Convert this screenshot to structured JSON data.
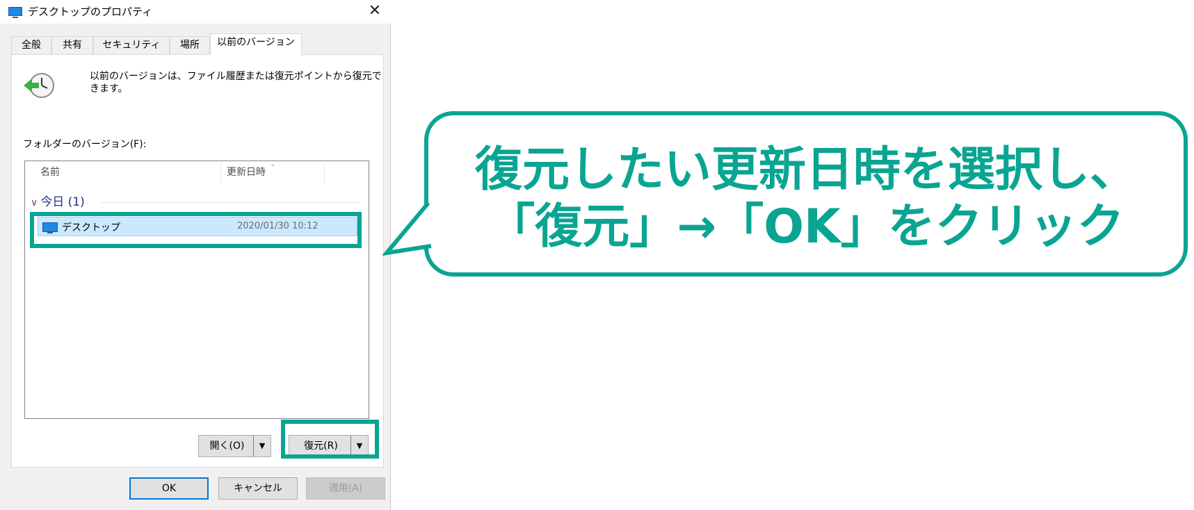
{
  "window": {
    "title": "デスクトップのプロパティ",
    "close_glyph": "✕"
  },
  "tabs": [
    {
      "label": "全般"
    },
    {
      "label": "共有"
    },
    {
      "label": "セキュリティ"
    },
    {
      "label": "場所"
    },
    {
      "label": "以前のバージョン",
      "active": true
    }
  ],
  "panel": {
    "description": "以前のバージョンは、ファイル履歴または復元ポイントから復元で\nきます。",
    "folder_versions_label": "フォルダーのバージョン(F):",
    "columns": {
      "name": "名前",
      "modified": "更新日時"
    },
    "group": {
      "label": "今日 (1)",
      "chevron": "∨"
    },
    "rows": [
      {
        "name": "デスクトップ",
        "modified": "2020/01/30 10:12",
        "selected": true
      }
    ]
  },
  "actions": {
    "open_label": "開く(O)",
    "restore_label": "復元(R)",
    "split_glyph": "▼"
  },
  "footer": {
    "ok_label": "OK",
    "cancel_label": "キャンセル",
    "apply_label": "適用(A)"
  },
  "callout": {
    "text": "復元したい更新日時を選択し、\n「復元」→「OK」をクリック"
  },
  "colors": {
    "accent": "#0aa592",
    "selection": "#cce8ff",
    "group_text": "#1e3287",
    "primary_border": "#0078d7"
  },
  "icons": {
    "title": "monitor-icon",
    "history": "clock-restore-icon",
    "row": "monitor-icon",
    "close": "close-icon"
  }
}
